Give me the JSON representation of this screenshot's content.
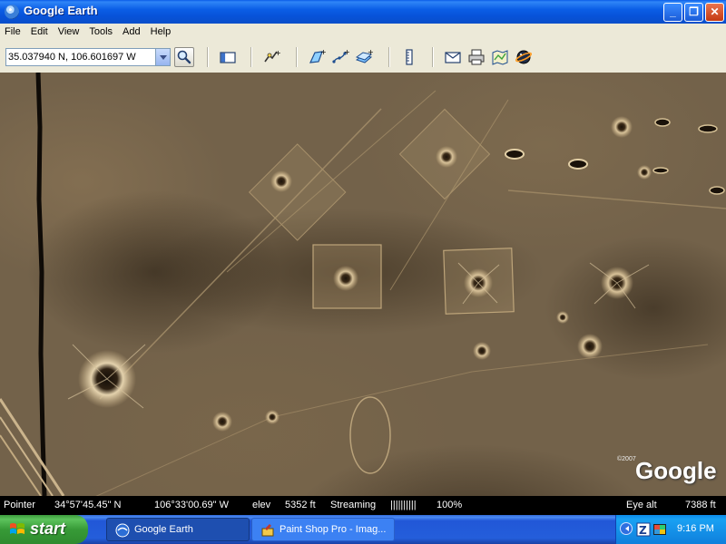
{
  "window": {
    "title": "Google Earth",
    "controls": {
      "minimize": "_",
      "maximize": "❐",
      "close": "✕"
    }
  },
  "menu": {
    "items": [
      "File",
      "Edit",
      "View",
      "Tools",
      "Add",
      "Help"
    ]
  },
  "toolbar": {
    "search_value": "35.037940 N, 106.601697 W",
    "icons": [
      "search-icon",
      "sidebar-toggle-icon",
      "placemark-icon",
      "polygon-icon",
      "path-icon",
      "image-overlay-icon",
      "ruler-icon",
      "email-icon",
      "print-icon",
      "maps-icon",
      "sky-icon"
    ]
  },
  "map": {
    "logo": "Google",
    "copyright": "©2007"
  },
  "status": {
    "pointer_label": "Pointer",
    "lat": "34°57'45.45\" N",
    "lon": "106°33'00.69\" W",
    "elev_label": "elev",
    "elev_value": "5352 ft",
    "streaming_label": "Streaming",
    "streaming_bar": "||||||||||",
    "streaming_pct": "100%",
    "eye_label": "Eye alt",
    "eye_value": "7388 ft"
  },
  "taskbar": {
    "start_label": "start",
    "tasks": [
      {
        "label": "Google Earth",
        "active": true
      },
      {
        "label": "Paint Shop Pro - Imag...",
        "active": false
      }
    ],
    "clock": "9:16 PM"
  },
  "colors": {
    "titlebar": "#0b5ee6",
    "terrain": "#73624a",
    "start_green": "#3c9a3c"
  }
}
